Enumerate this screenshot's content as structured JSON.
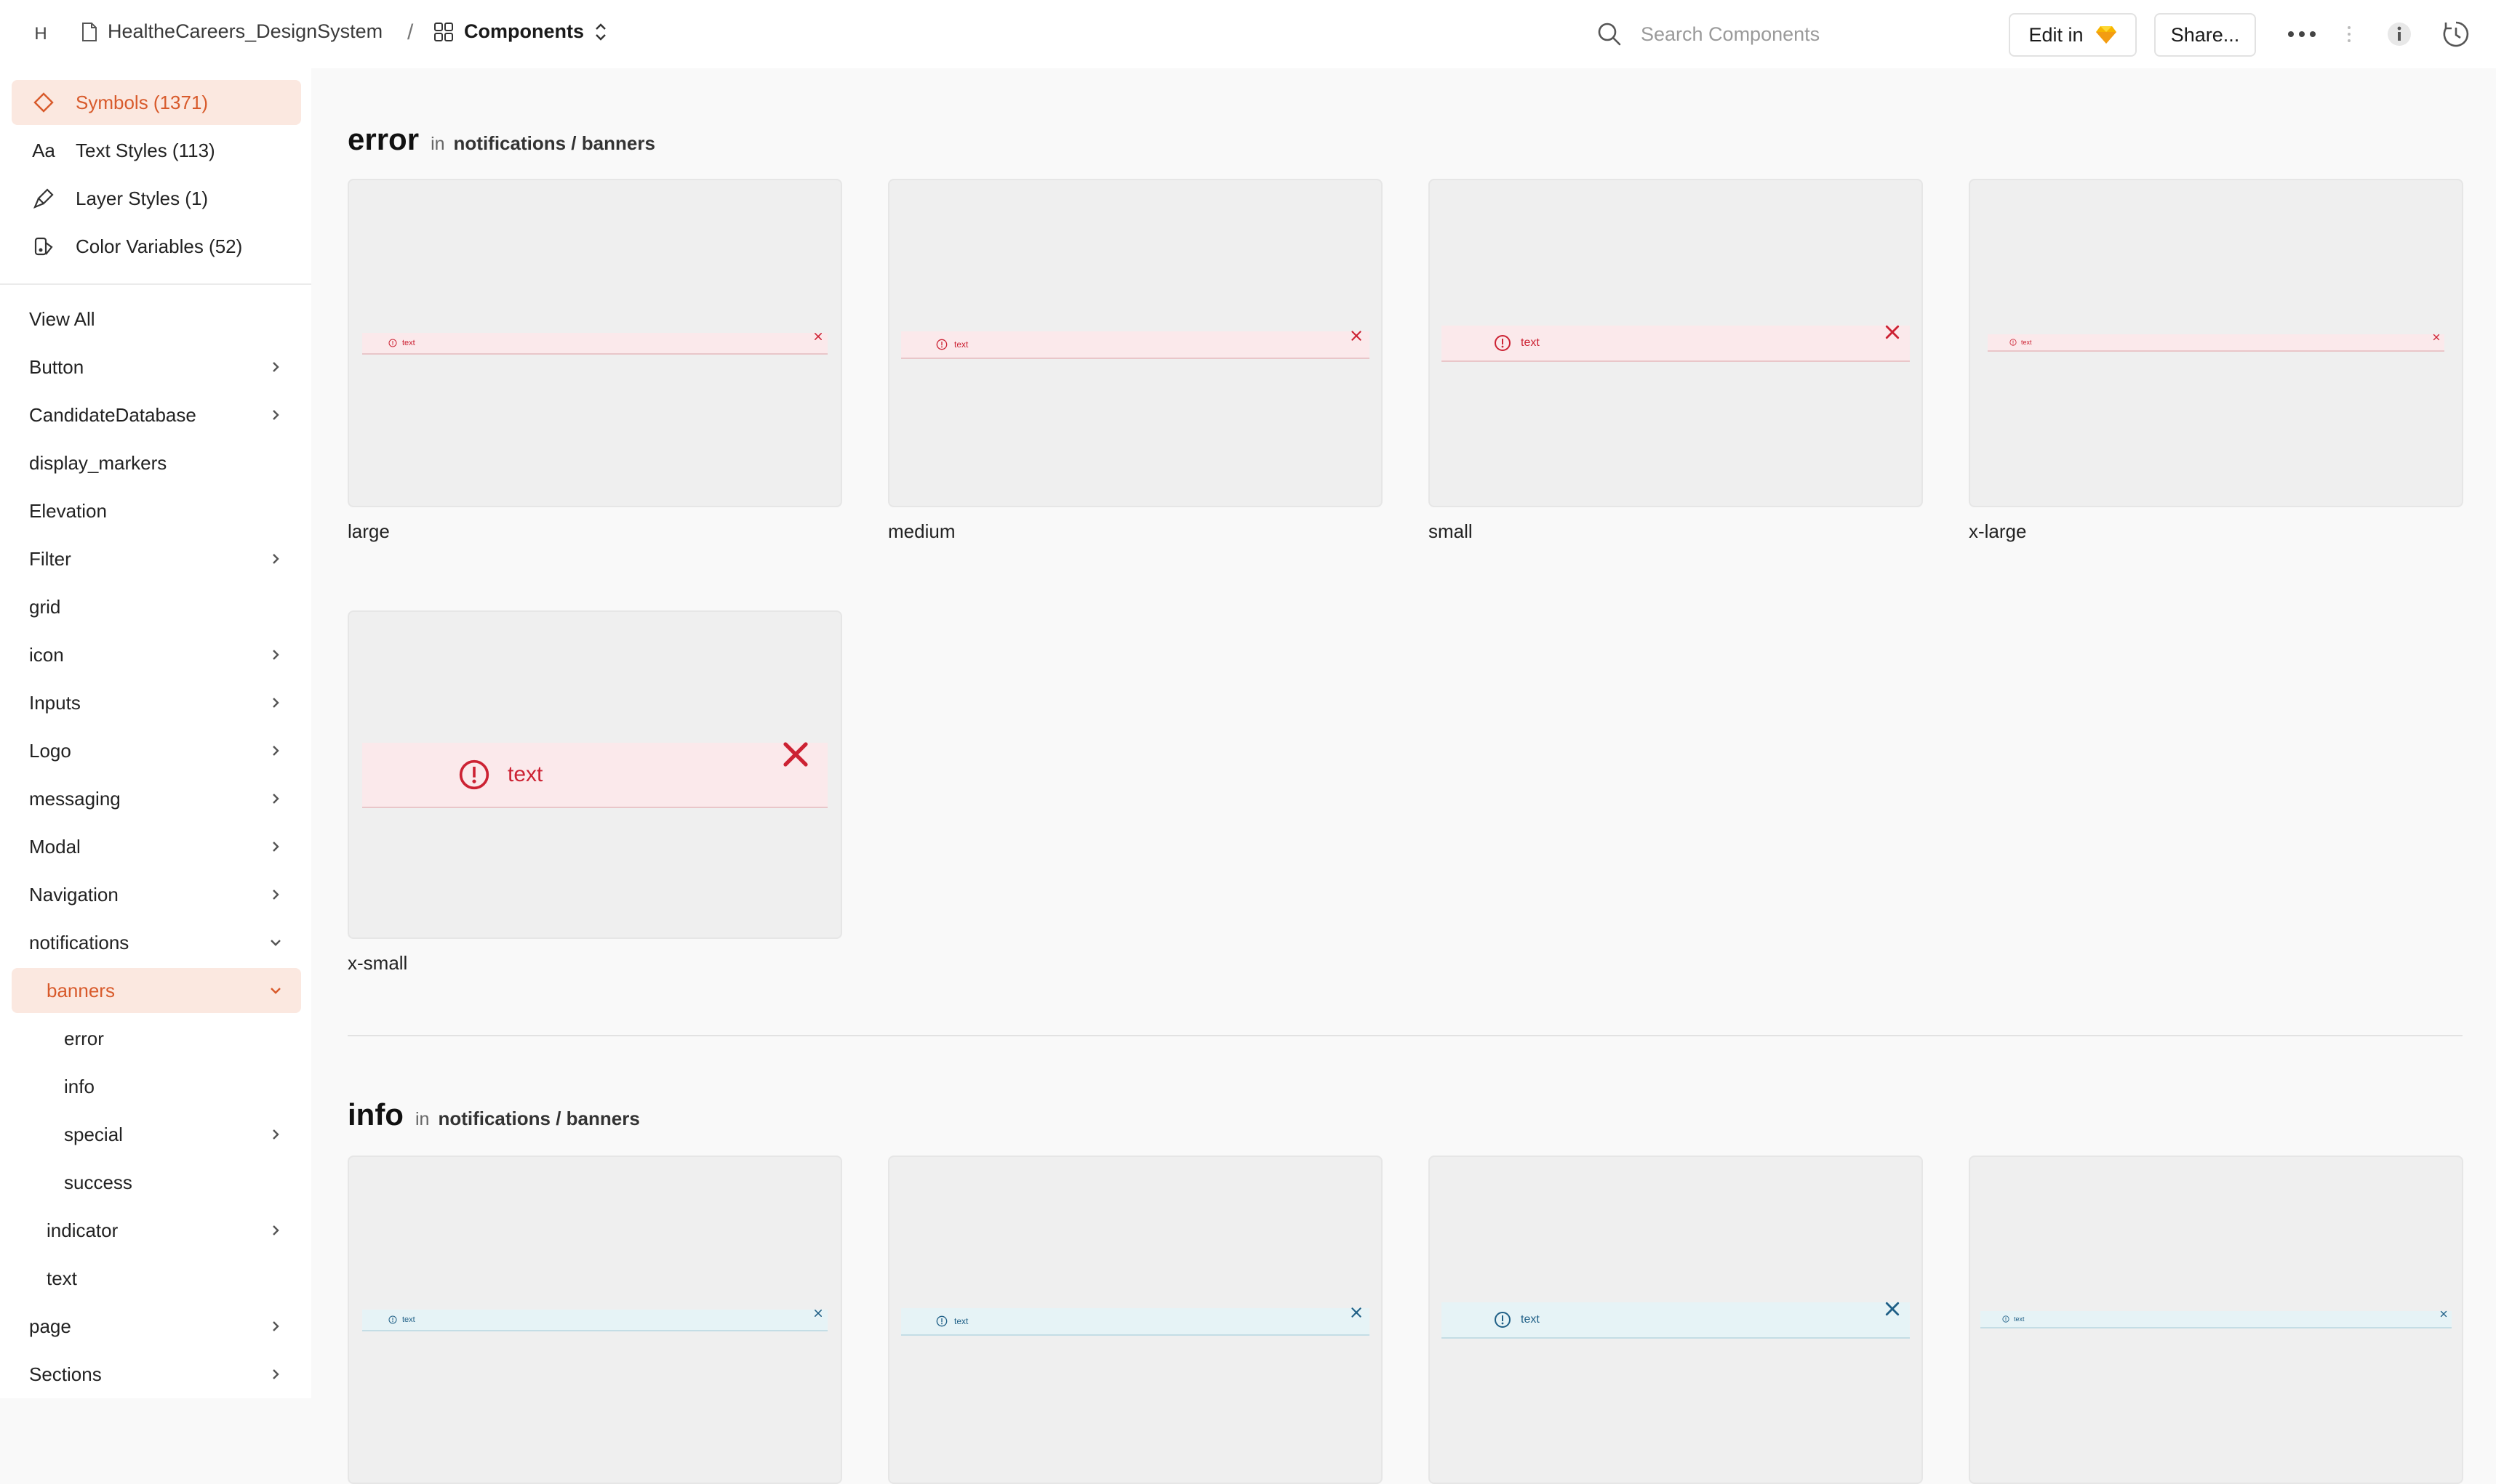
{
  "topbar": {
    "avatar": "H",
    "document": "HealtheCareers_DesignSystem",
    "separator": "/",
    "section": "Components",
    "search_placeholder": "Search Components",
    "edit_label": "Edit in",
    "share_label": "Share..."
  },
  "sidebar": {
    "assets": [
      {
        "label": "Symbols (1371)",
        "icon": "diamond-icon",
        "active": true
      },
      {
        "label": "Text Styles (113)",
        "icon": "text-style-icon",
        "active": false
      },
      {
        "label": "Layer Styles (1)",
        "icon": "brush-icon",
        "active": false
      },
      {
        "label": "Color Variables (52)",
        "icon": "color-bucket-icon",
        "active": false
      }
    ],
    "nav": [
      {
        "label": "View All",
        "chevron": "none"
      },
      {
        "label": "Button",
        "chevron": "right"
      },
      {
        "label": "CandidateDatabase",
        "chevron": "right"
      },
      {
        "label": "display_markers",
        "chevron": "none"
      },
      {
        "label": "Elevation",
        "chevron": "none"
      },
      {
        "label": "Filter",
        "chevron": "right"
      },
      {
        "label": "grid",
        "chevron": "none"
      },
      {
        "label": "icon",
        "chevron": "right"
      },
      {
        "label": "Inputs",
        "chevron": "right"
      },
      {
        "label": "Logo",
        "chevron": "right"
      },
      {
        "label": "messaging",
        "chevron": "right"
      },
      {
        "label": "Modal",
        "chevron": "right"
      },
      {
        "label": "Navigation",
        "chevron": "right"
      },
      {
        "label": "notifications",
        "chevron": "down"
      },
      {
        "label": "banners",
        "chevron": "down",
        "active": true
      },
      {
        "label": "error",
        "chevron": "none"
      },
      {
        "label": "info",
        "chevron": "none"
      },
      {
        "label": "special",
        "chevron": "right"
      },
      {
        "label": "success",
        "chevron": "none"
      },
      {
        "label": "indicator",
        "chevron": "right"
      },
      {
        "label": "text",
        "chevron": "none"
      },
      {
        "label": "page",
        "chevron": "right"
      },
      {
        "label": "Sections",
        "chevron": "right"
      }
    ]
  },
  "sections": [
    {
      "name": "error",
      "in": "in",
      "path": "notifications / banners",
      "accent": "#cc2233",
      "banner_bg": "#fbe9eb",
      "cards": [
        {
          "label": "large",
          "banner_text": "text"
        },
        {
          "label": "medium",
          "banner_text": "text"
        },
        {
          "label": "small",
          "banner_text": "text"
        },
        {
          "label": "x-large",
          "banner_text": "text"
        },
        {
          "label": "x-small",
          "banner_text": "text"
        }
      ]
    },
    {
      "name": "info",
      "in": "in",
      "path": "notifications / banners",
      "accent": "#1f5f86",
      "banner_bg": "#e6f3f6",
      "cards": [
        {
          "banner_text": "text"
        },
        {
          "banner_text": "text"
        },
        {
          "banner_text": "text"
        },
        {
          "banner_text": "text"
        }
      ]
    }
  ],
  "colors": {
    "accent": "#d85a2b",
    "active_bg": "#fbe8e0"
  }
}
